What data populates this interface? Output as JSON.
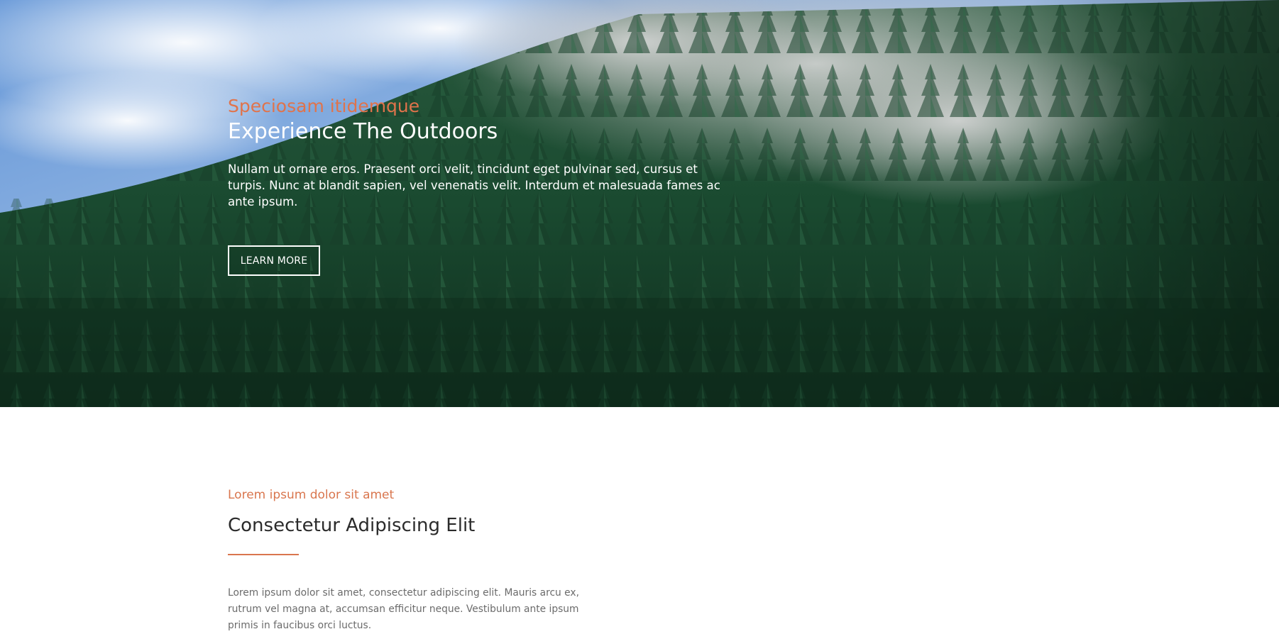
{
  "hero": {
    "eyebrow": "Speciosam itidemque",
    "title": "Experience The Outdoors",
    "text": "Nullam ut ornare eros. Praesent orci velit, tincidunt eget pulvinar sed, cursus et turpis. Nunc at blandit sapien, vel venenatis velit. Interdum et malesuada fames ac ante ipsum.",
    "button_label": "LEARN MORE",
    "image": "forest-mountain-mist-photo"
  },
  "intro": {
    "eyebrow": "Lorem ipsum dolor sit amet",
    "title": "Consectetur Adipiscing Elit",
    "text": "Lorem ipsum dolor sit amet, consectetur adipiscing elit. Mauris arcu ex, rutrum vel magna at, accumsan efficitur neque. Vestibulum ante ipsum primis in faucibus orci luctus."
  },
  "colors": {
    "accent": "#e0734b",
    "heading": "#2b2b2b",
    "body": "#6b6b6b",
    "forest": "#1d4a32",
    "sky": "#6f9fd8"
  }
}
